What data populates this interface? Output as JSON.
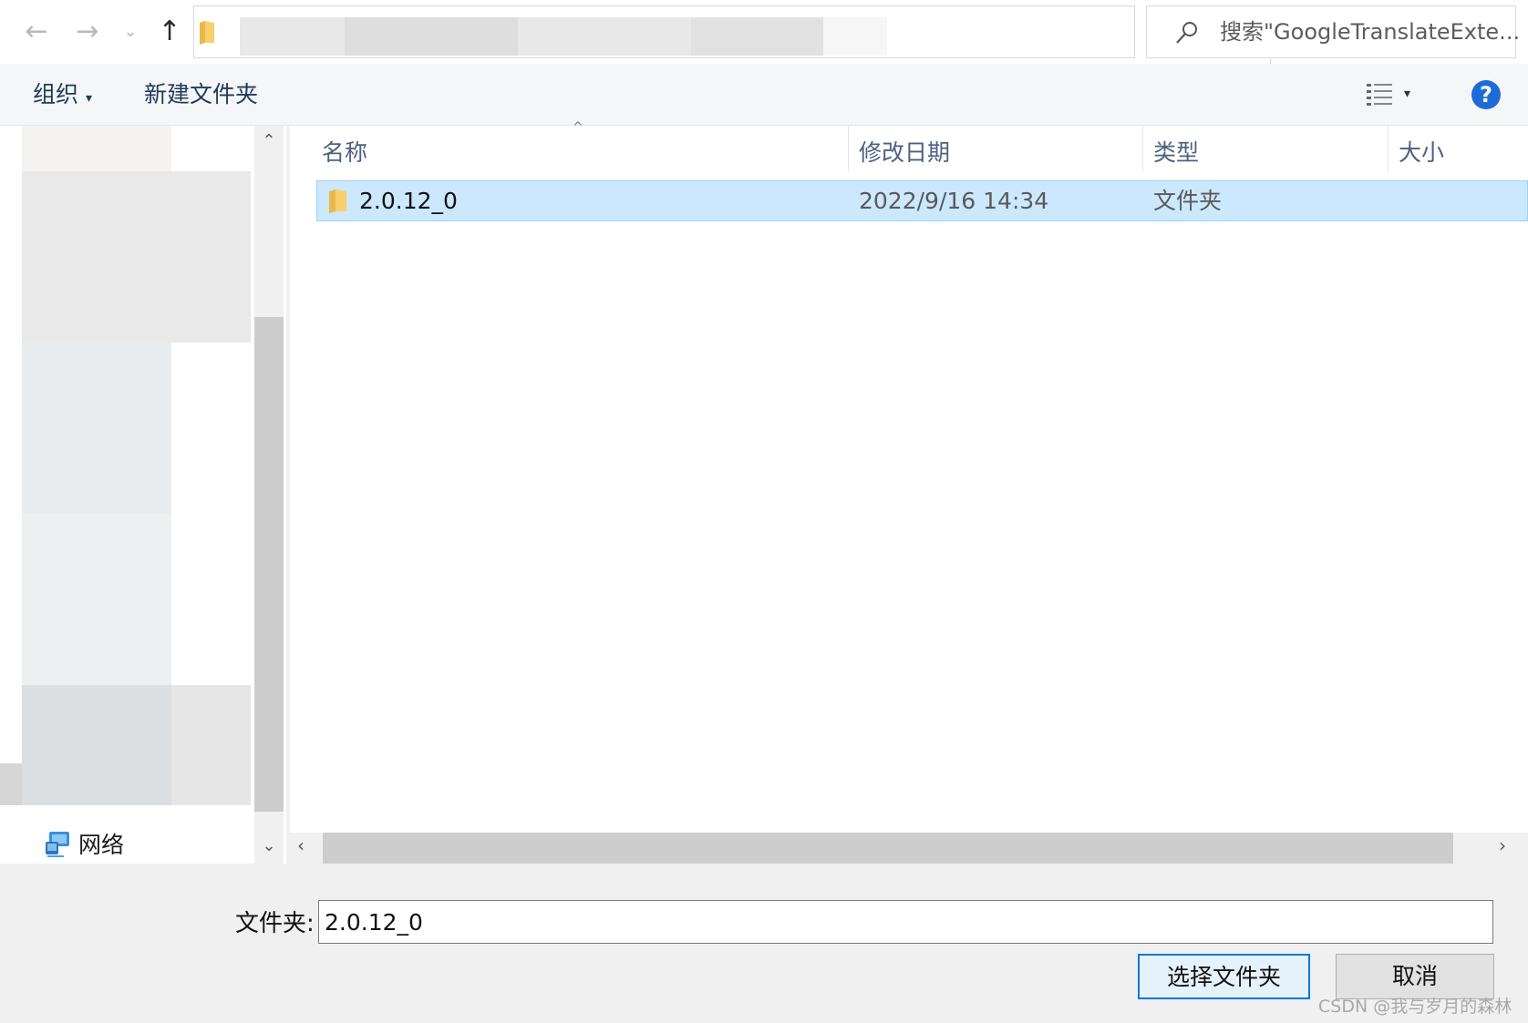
{
  "search": {
    "placeholder": "搜索\"GoogleTranslateExte..."
  },
  "toolbar": {
    "organize_label": "组织",
    "new_folder_label": "新建文件夹",
    "help_label": "?"
  },
  "nav": {
    "network_label": "网络"
  },
  "columns": {
    "name": "名称",
    "modified": "修改日期",
    "type": "类型",
    "size": "大小"
  },
  "files": [
    {
      "name": "2.0.12_0",
      "modified": "2022/9/16 14:34",
      "type": "文件夹",
      "size": ""
    }
  ],
  "footer": {
    "folder_label": "文件夹:",
    "folder_value": "2.0.12_0",
    "select_button": "选择文件夹",
    "cancel_button": "取消"
  },
  "watermark": "CSDN @我与岁月的森林",
  "colors": {
    "selection": "#cce8ff",
    "accent": "#0078d7",
    "help": "#1d6bd6"
  },
  "icons": [
    "back-icon",
    "forward-icon",
    "recent-dropdown-icon",
    "up-icon",
    "folder-icon",
    "chevron-down-icon",
    "refresh-icon",
    "search-icon",
    "view-options-icon",
    "help-icon",
    "network-icon",
    "sort-ascending-icon"
  ]
}
